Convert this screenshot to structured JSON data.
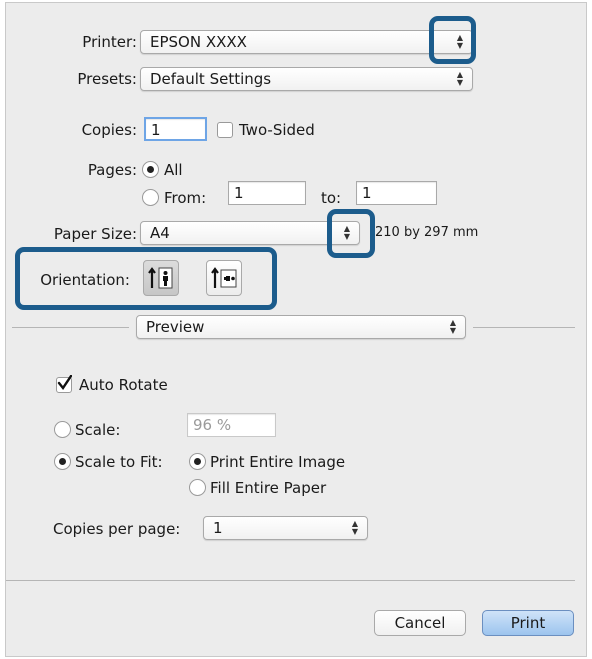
{
  "printer": {
    "label": "Printer:",
    "value": "EPSON XXXX"
  },
  "presets": {
    "label": "Presets:",
    "value": "Default Settings"
  },
  "copies": {
    "label": "Copies:",
    "value": "1",
    "two_sided_label": "Two-Sided"
  },
  "pages": {
    "label": "Pages:",
    "all_label": "All",
    "from_label": "From:",
    "from_value": "1",
    "to_label": "to:",
    "to_value": "1"
  },
  "paper_size": {
    "label": "Paper Size:",
    "value": "A4",
    "dimensions": "210 by 297 mm"
  },
  "orientation": {
    "label": "Orientation:"
  },
  "section_popup": {
    "value": "Preview"
  },
  "auto_rotate": {
    "label": "Auto Rotate",
    "checked": true
  },
  "scale": {
    "label": "Scale:",
    "value": "96 %"
  },
  "scale_to_fit": {
    "label": "Scale to Fit:",
    "print_entire_label": "Print Entire Image",
    "fill_entire_label": "Fill Entire Paper"
  },
  "copies_per_page": {
    "label": "Copies per page:",
    "value": "1"
  },
  "buttons": {
    "cancel": "Cancel",
    "print": "Print"
  },
  "colors": {
    "highlight": "#1c5c8c",
    "default_button": "#9cc4ee"
  }
}
